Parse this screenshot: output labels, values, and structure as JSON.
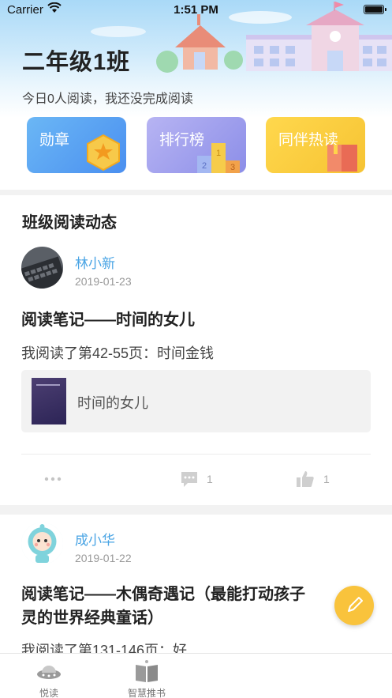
{
  "status_bar": {
    "carrier": "Carrier",
    "time": "1:51 PM"
  },
  "header": {
    "class_name": "二年级1班",
    "reading_status": "今日0人阅读，我还没完成阅读"
  },
  "features": [
    {
      "label": "勋章",
      "icon": "medal-icon"
    },
    {
      "label": "排行榜",
      "icon": "podium-icon"
    },
    {
      "label": "同伴热读",
      "icon": "book-icon"
    }
  ],
  "feed": {
    "title": "班级阅读动态",
    "posts": [
      {
        "user": "林小新",
        "date": "2019-01-23",
        "title": "阅读笔记——时间的女儿",
        "excerpt": "我阅读了第42-55页：时间金钱",
        "book_title": "时间的女儿",
        "comments": "1",
        "likes": "1"
      },
      {
        "user": "成小华",
        "date": "2019-01-22",
        "title_line1": "阅读笔记——木偶奇遇记（最能打动孩子",
        "title_line2": "灵的世界经典童话）",
        "excerpt": "我阅读了第131-146页：好"
      }
    ]
  },
  "tab_bar": [
    {
      "label": "悦读",
      "icon": "ufo-icon"
    },
    {
      "label": "智慧推书",
      "icon": "open-book-icon"
    }
  ],
  "colors": {
    "accent_blue": "#49a4e4",
    "fab_yellow": "#f9c33c"
  }
}
